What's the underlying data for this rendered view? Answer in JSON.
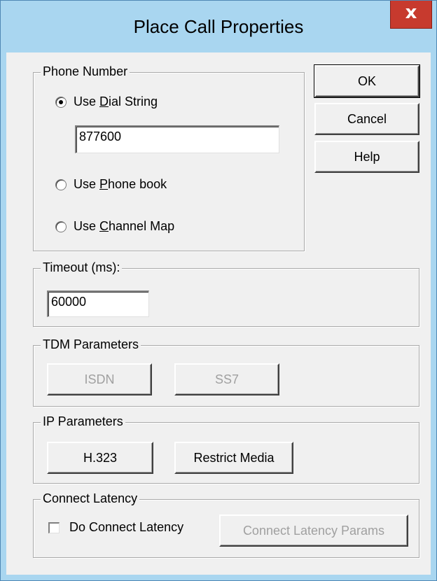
{
  "window": {
    "title": "Place Call Properties",
    "close_glyph": "x"
  },
  "phone_number": {
    "legend": "Phone Number",
    "options": [
      {
        "pre": "Use ",
        "accel": "D",
        "post": "ial String",
        "checked": true
      },
      {
        "pre": "Use ",
        "accel": "P",
        "post": "hone book",
        "checked": false
      },
      {
        "pre": "Use ",
        "accel": "C",
        "post": "hannel Map",
        "checked": false
      }
    ],
    "dial_string_value": "877600"
  },
  "buttons": {
    "ok": "OK",
    "cancel": "Cancel",
    "help": "Help"
  },
  "timeout": {
    "legend": "Timeout (ms):",
    "value": "60000"
  },
  "tdm": {
    "legend": "TDM Parameters",
    "isdn": "ISDN",
    "ss7": "SS7"
  },
  "ip": {
    "legend": "IP Parameters",
    "h323": "H.323",
    "restrict_media": "Restrict Media"
  },
  "latency": {
    "legend": "Connect Latency",
    "checkbox_label": "Do Connect Latency",
    "checked": false,
    "params_button": "Connect Latency Params"
  }
}
